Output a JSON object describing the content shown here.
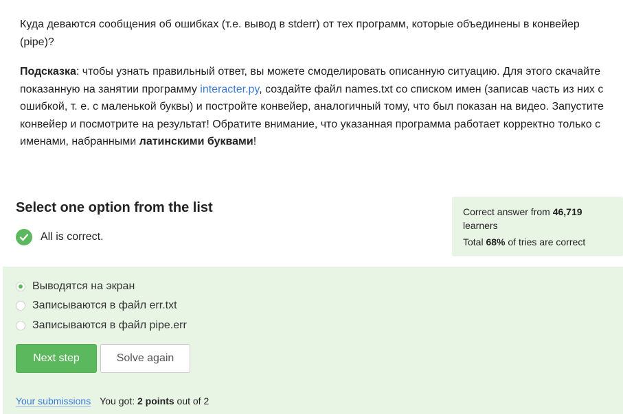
{
  "question": {
    "text": "Куда деваются сообщения об ошибках (т.е. вывод в stderr) от тех программ, которые объединены в конвейер (pipe)?"
  },
  "hint": {
    "label": "Подсказка",
    "part1": ": чтобы узнать правильный ответ, вы можете смоделировать описанную ситуацию. Для этого скачайте показанную на занятии программу ",
    "link": "interacter.py",
    "part2": ", создайте файл names.txt со списком имен (записав часть из них с ошибкой, т. е. с маленькой буквы) и постройте конвейер, аналогичный тому, что был показан на видео. Запустите конвейер и посмотрите на результат! Обратите внимание, что указанная программа работает корректно только с именами, набранными ",
    "bold": "латинскими буквами",
    "part3": "!"
  },
  "select_title": "Select one option from the list",
  "result": {
    "text": "All is correct.",
    "icon": "check-circle-icon",
    "color": "#5cb85c"
  },
  "stats": {
    "correct_prefix": "Correct answer from ",
    "learners_count": "46,719",
    "learners_suffix": "learners",
    "total_prefix": "Total ",
    "percent": "68%",
    "total_suffix": " of tries are correct"
  },
  "options": [
    {
      "label": "Выводятся на экран",
      "selected": true
    },
    {
      "label": "Записываются в файл err.txt",
      "selected": false
    },
    {
      "label": "Записываются в файл pipe.err",
      "selected": false
    }
  ],
  "buttons": {
    "next": "Next step",
    "solve_again": "Solve again"
  },
  "footer": {
    "submissions_link": "Your submissions",
    "got_prefix": "You got: ",
    "points": "2 points",
    "out_of": " out of 2"
  },
  "colors": {
    "accent_green": "#5cb85c",
    "panel_bg": "#e8f4e4",
    "link": "#3a7bd5"
  }
}
